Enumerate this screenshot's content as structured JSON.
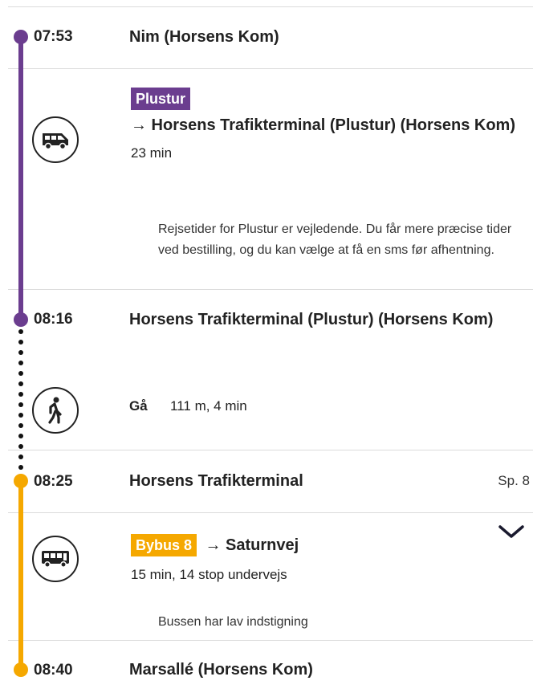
{
  "colors": {
    "plustur": "#6b3d8f",
    "bybus": "#f5a800"
  },
  "stops": [
    {
      "time": "07:53",
      "name": "Nim (Horsens Kom)"
    },
    {
      "time": "08:16",
      "name": "Horsens Trafikterminal (Plustur) (Horsens Kom)"
    },
    {
      "time": "08:25",
      "name": "Horsens Trafikterminal",
      "platform": "Sp. 8"
    },
    {
      "time": "08:40",
      "name": "Marsallé (Horsens Kom)"
    }
  ],
  "legs": [
    {
      "icon": "van-icon",
      "badge": "Plustur",
      "destination": "→ Horsens Trafikterminal (Plustur) (Horsens Kom)",
      "duration": "23 min",
      "note": "Rejsetider for Plustur er vejledende. Du får mere præcise tider ved bestilling, og du kan vælge at få en sms før afhentning."
    },
    {
      "icon": "walking-person-icon",
      "label": "Gå",
      "info": "111 m, 4 min"
    },
    {
      "icon": "bus-icon",
      "badge": "Bybus 8",
      "destination": "→ Saturnvej",
      "duration": "15 min, 14 stop undervejs",
      "note": "Bussen har lav indstigning"
    }
  ]
}
